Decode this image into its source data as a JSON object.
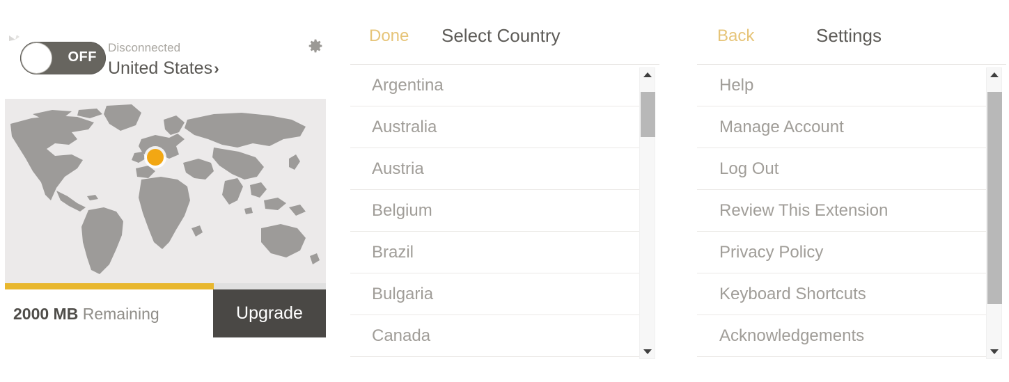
{
  "main_panel": {
    "toggle": {
      "state_label": "OFF",
      "on": false
    },
    "status_label": "Disconnected",
    "country": "United States",
    "chevron": "›",
    "gear_icon": "gear-icon",
    "map": {
      "location_dot_color": "#f2a713",
      "land_color": "#9d9b99",
      "sea_color": "#eceaea"
    },
    "usage": {
      "amount": "2000 MB",
      "remaining_label": "Remaining",
      "bar_fill_percent": 65,
      "bar_color": "#e8b72e"
    },
    "upgrade_label": "Upgrade"
  },
  "country_panel": {
    "action_label": "Done",
    "title": "Select Country",
    "items": [
      "Argentina",
      "Australia",
      "Austria",
      "Belgium",
      "Brazil",
      "Bulgaria",
      "Canada"
    ],
    "scrollbar": {
      "thumb_top_percent": 4,
      "thumb_height_percent": 17
    }
  },
  "settings_panel": {
    "action_label": "Back",
    "title": "Settings",
    "items": [
      "Help",
      "Manage Account",
      "Log Out",
      "Review This Extension",
      "Privacy Policy",
      "Keyboard Shortcuts",
      "Acknowledgements"
    ],
    "scrollbar": {
      "thumb_top_percent": 4,
      "thumb_height_percent": 80
    }
  },
  "colors": {
    "accent_orange": "#e6c478",
    "yellow_bar": "#e8b72e",
    "dark_button": "#4a4845",
    "text_grey": "#a09d98",
    "title_grey": "#5d5b57"
  }
}
